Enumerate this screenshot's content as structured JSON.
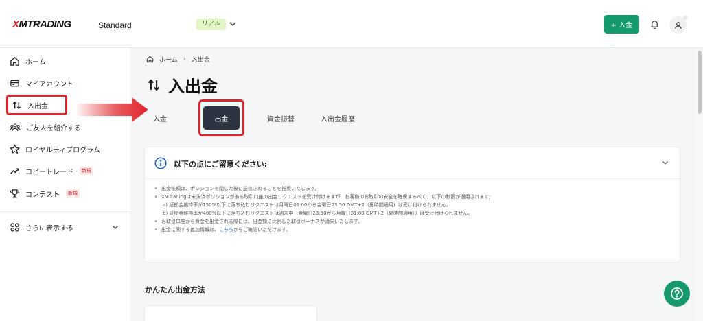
{
  "header": {
    "brand": "XMTRADING",
    "brand_mark": "X",
    "brand_rest": "MTRADING",
    "account_type": "Standard",
    "account_badge": "リアル",
    "deposit_button": "+ 入金"
  },
  "sidebar": {
    "items": [
      {
        "label": "ホーム",
        "icon": "home-icon"
      },
      {
        "label": "マイアカウント",
        "icon": "wallet-icon"
      },
      {
        "label": "入出金",
        "icon": "transfer-arrows-icon",
        "selected": true
      },
      {
        "label": "ご友人を紹介する",
        "icon": "people-icon"
      },
      {
        "label": "ロイヤルティプログラム",
        "icon": "star-icon"
      },
      {
        "label": "コピートレード",
        "icon": "trend-icon",
        "badge": "新規"
      },
      {
        "label": "コンテスト",
        "icon": "trophy-icon",
        "badge": "新規"
      }
    ],
    "more_label": "さらに表示する"
  },
  "breadcrumb": {
    "home": "ホーム",
    "current": "入出金"
  },
  "page_title": "入出金",
  "tabs": [
    {
      "label": "入金"
    },
    {
      "label": "出金",
      "selected": true
    },
    {
      "label": "資金振替"
    },
    {
      "label": "入出金履歴"
    }
  ],
  "notice": {
    "title": "以下の点にご留意ください:",
    "items": [
      "出金依頼は、ポジションを閉じた後に送信されることを推奨いたします。",
      "XMTradingは未決済ポジションがある取引口座の出金リクエストを受け付けますが、お客様のお取引の安全を確保するべく、以下の制限が適用されます:",
      "a) 証拠金維持率が150%以下に落ち込むリクエストは月曜日01:00から金曜日23:50 GMT+2（夏時間適用）は受け付けられません。",
      "b) 証拠金維持率が400%以下に落ち込むリクエストは週末中（金曜日23:50から月曜日01:00 GMT+2（夏時間適用））は受け付けられません。",
      "お取引口座から資金を出金される際には、出金額に比例した取引ボーナスが消失いたします。"
    ],
    "last_prefix": "出金に関する追加情報は、",
    "last_link": "こちら",
    "last_suffix": "からご確認いただけます。"
  },
  "section_title": "かんたん出金方法",
  "colors": {
    "accent_green": "#159a6e",
    "highlight_red": "#e0252b",
    "tab_active": "#2d3441",
    "badge_bg": "#e3f5c9"
  }
}
